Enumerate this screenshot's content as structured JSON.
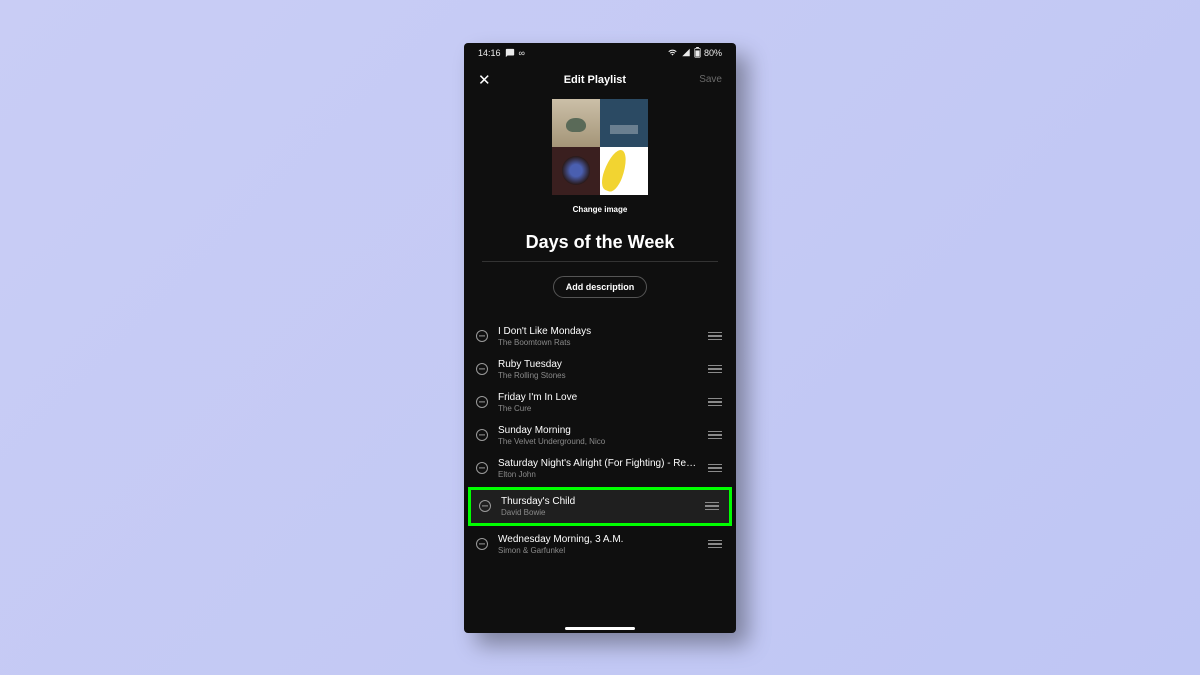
{
  "status": {
    "time": "14:16",
    "battery": "80%"
  },
  "header": {
    "title": "Edit Playlist",
    "save_label": "Save"
  },
  "cover": {
    "change_label": "Change image"
  },
  "playlist": {
    "name": "Days of the Week",
    "add_description_label": "Add description"
  },
  "tracks": [
    {
      "title": "I Don't Like Mondays",
      "artist": "The Boomtown Rats"
    },
    {
      "title": "Ruby Tuesday",
      "artist": "The Rolling Stones"
    },
    {
      "title": "Friday I'm In Love",
      "artist": "The Cure"
    },
    {
      "title": "Sunday Morning",
      "artist": "The Velvet Underground, Nico"
    },
    {
      "title": "Saturday Night's Alright (For Fighting) - Rem…",
      "artist": "Elton John"
    },
    {
      "title": "Thursday's Child",
      "artist": "David Bowie"
    },
    {
      "title": "Wednesday Morning, 3 A.M.",
      "artist": "Simon & Garfunkel"
    }
  ],
  "highlighted_index": 5
}
